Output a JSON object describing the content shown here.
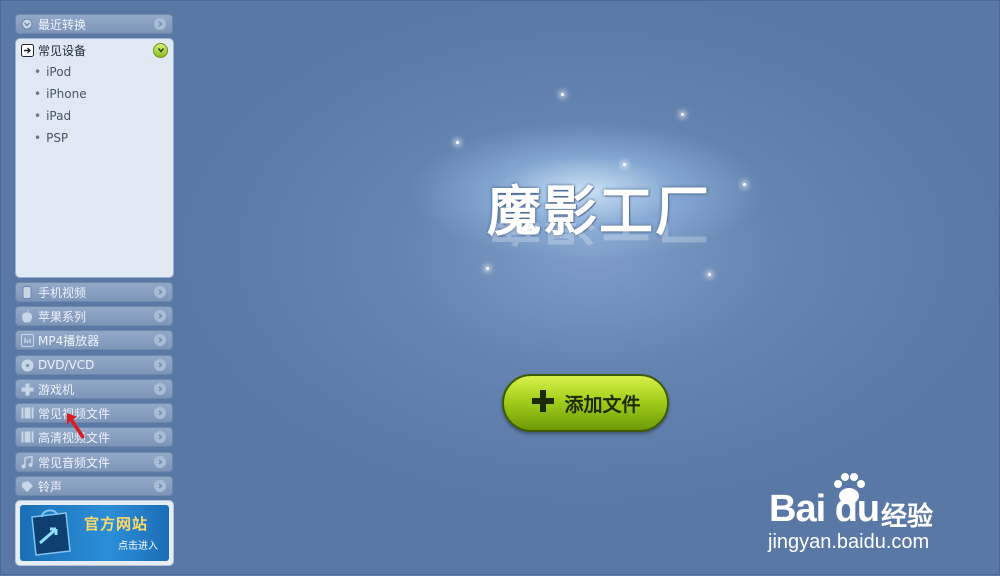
{
  "sidebar": {
    "recent": {
      "label": "最近转换",
      "icon": "clock-icon"
    },
    "devices_panel": {
      "title": "常见设备",
      "icon": "enter-icon",
      "items": [
        "iPod",
        "iPhone",
        "iPad",
        "PSP"
      ]
    },
    "categories": [
      {
        "label": "手机视频",
        "icon": "phone-icon"
      },
      {
        "label": "苹果系列",
        "icon": "apple-icon"
      },
      {
        "label": "MP4播放器",
        "icon": "mp4-player-icon"
      },
      {
        "label": "DVD/VCD",
        "icon": "disc-icon"
      },
      {
        "label": "游戏机",
        "icon": "gamepad-icon"
      },
      {
        "label": "常见视频文件",
        "icon": "film-icon"
      },
      {
        "label": "高清视频文件",
        "icon": "hd-film-icon"
      },
      {
        "label": "常见音频文件",
        "icon": "music-icon"
      },
      {
        "label": "铃声",
        "icon": "ringtone-icon"
      }
    ],
    "promo": {
      "title": "官方网站",
      "subtitle": "点击进入"
    }
  },
  "main": {
    "logo": "魔影工厂",
    "add_button": "添加文件"
  },
  "watermark": {
    "brand": "Bai du",
    "brand_cn": "经验",
    "url": "jingyan.baidu.com"
  },
  "colors": {
    "background": "#5f7ca8",
    "add_button_green": "#a4cf1c",
    "panel_bg": "#dfe8f3"
  }
}
